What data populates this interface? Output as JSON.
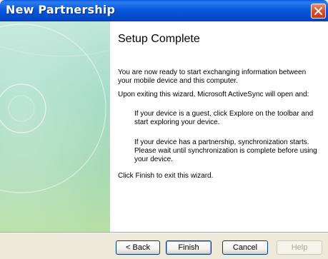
{
  "window": {
    "title": "New Partnership"
  },
  "content": {
    "heading": "Setup Complete",
    "p1": "You are now ready to start exchanging information between your mobile device and this computer.",
    "p2": "Upon exiting this wizard, Microsoft ActiveSync will open and:",
    "p3": "If your device is a guest, click Explore on the toolbar and start exploring your device.",
    "p4": "If your device has a partnership, synchronization starts. Please wait until synchronization is complete before using your device.",
    "p5": "Click Finish to exit this wizard."
  },
  "buttons": {
    "back": "< Back",
    "finish": "Finish",
    "cancel": "Cancel",
    "help": "Help"
  },
  "icons": {
    "close": "close-icon"
  },
  "colors": {
    "titlebar": "#0958da",
    "close_button": "#d9502f",
    "left_panel": "#a6dcc8"
  }
}
